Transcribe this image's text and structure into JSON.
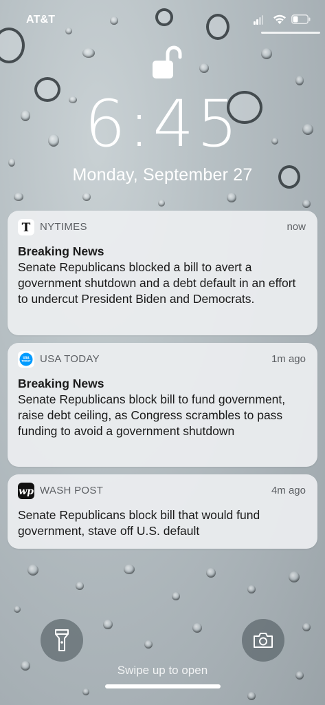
{
  "status_bar": {
    "carrier": "AT&T",
    "signal_icon": "cellular-signal-icon",
    "wifi_icon": "wifi-icon",
    "battery_icon": "battery-icon"
  },
  "lock": {
    "icon": "unlocked-padlock-icon",
    "time": "6:45",
    "date": "Monday, September 27"
  },
  "notifications": [
    {
      "app": "NYTIMES",
      "icon": "nytimes-logo-icon",
      "time": "now",
      "title": "Breaking News",
      "body": "Senate Republicans blocked a bill to avert a government shutdown and a debt default in an effort to undercut President Biden and Democrats."
    },
    {
      "app": "USA TODAY",
      "icon": "usa-today-logo-icon",
      "time": "1m ago",
      "title": "Breaking News",
      "body": "Senate Republicans block bill to fund government, raise debt ceiling, as Congress scrambles to pass funding to avoid a government shutdown"
    },
    {
      "app": "WASH POST",
      "icon": "washington-post-logo-icon",
      "time": "4m ago",
      "title": "",
      "body": "Senate Republicans block bill that would fund government, stave off U.S. default"
    }
  ],
  "controls": {
    "flashlight_icon": "flashlight-icon",
    "camera_icon": "camera-icon"
  },
  "swipe_hint": "Swipe up to open",
  "colors": {
    "usa_today_blue": "#009bff",
    "notification_bg": "#eceef0"
  }
}
